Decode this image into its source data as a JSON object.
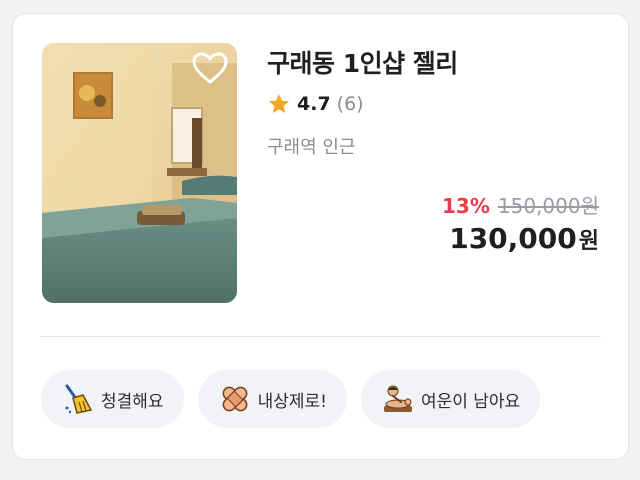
{
  "listing": {
    "title": "구래동 1인샵 젤리",
    "rating": "4.7",
    "review_count": "(6)",
    "location": "구래역 인근",
    "discount": "13%",
    "original_price": "150,000원",
    "final_price": "130,000",
    "currency": "원"
  },
  "tags": [
    {
      "label": "청결해요",
      "icon": "broom-icon"
    },
    {
      "label": "내상제로!",
      "icon": "bandage-icon"
    },
    {
      "label": "여운이 남아요",
      "icon": "massage-icon"
    }
  ],
  "colors": {
    "discount": "#ea3c4e",
    "star": "#f5a623",
    "tag_bg": "#f2f3f6"
  }
}
